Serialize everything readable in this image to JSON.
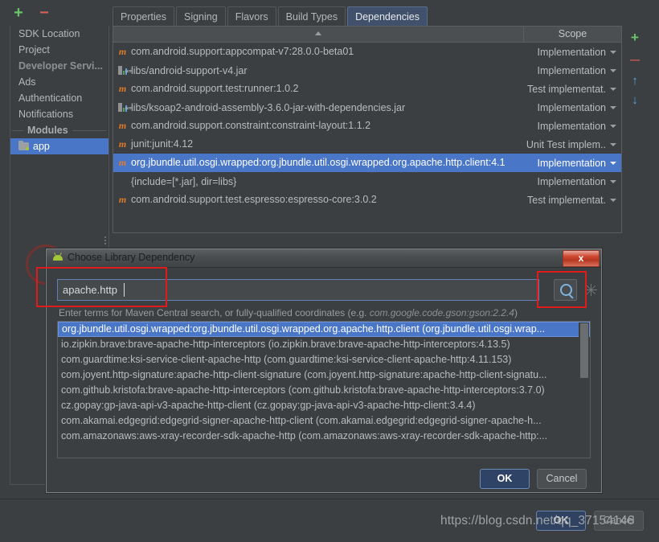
{
  "project_toolbar": {
    "add_label": "+",
    "remove_label": "−"
  },
  "sidebar": {
    "items": [
      {
        "label": "SDK Location",
        "style": "normal"
      },
      {
        "label": "Project",
        "style": "normal"
      },
      {
        "label": "Developer Servi...",
        "style": "dim"
      },
      {
        "label": "Ads",
        "style": "normal"
      },
      {
        "label": "Authentication",
        "style": "normal"
      },
      {
        "label": "Notifications",
        "style": "normal"
      }
    ],
    "group_label": "Modules",
    "module": {
      "label": "app",
      "icon": "folder-icon",
      "selected": true
    }
  },
  "tabs": [
    {
      "label": "Properties",
      "active": false
    },
    {
      "label": "Signing",
      "active": false
    },
    {
      "label": "Flavors",
      "active": false
    },
    {
      "label": "Build Types",
      "active": false
    },
    {
      "label": "Dependencies",
      "active": true
    }
  ],
  "dependencies_table": {
    "columns": [
      "",
      "Scope"
    ],
    "sort_indicator": "ascending",
    "rows": [
      {
        "icon": "maven-icon",
        "name": "com.android.support:appcompat-v7:28.0.0-beta01",
        "scope": "Implementation",
        "has_chevron": true,
        "selected": false
      },
      {
        "icon": "jar-icon",
        "name": "libs/android-support-v4.jar",
        "scope": "Implementation",
        "has_chevron": true,
        "selected": false
      },
      {
        "icon": "maven-icon",
        "name": "com.android.support.test:runner:1.0.2",
        "scope": "Test implementat.",
        "has_chevron": true,
        "selected": false
      },
      {
        "icon": "jar-icon",
        "name": "libs/ksoap2-android-assembly-3.6.0-jar-with-dependencies.jar",
        "scope": "Implementation",
        "has_chevron": true,
        "selected": false
      },
      {
        "icon": "maven-icon",
        "name": "com.android.support.constraint:constraint-layout:1.1.2",
        "scope": "Implementation",
        "has_chevron": true,
        "selected": false
      },
      {
        "icon": "maven-icon",
        "name": "junit:junit:4.12",
        "scope": "Unit Test implem..",
        "has_chevron": true,
        "selected": false
      },
      {
        "icon": "maven-icon",
        "name": "org.jbundle.util.osgi.wrapped:org.jbundle.util.osgi.wrapped.org.apache.http.client:4.1",
        "scope": "Implementation",
        "has_chevron": true,
        "selected": true
      },
      {
        "icon": "none",
        "name": "{include=[*.jar], dir=libs}",
        "scope": "Implementation",
        "has_chevron": true,
        "selected": false
      },
      {
        "icon": "maven-icon",
        "name": "com.android.support.test.espresso:espresso-core:3.0.2",
        "scope": "Test implementat.",
        "has_chevron": true,
        "selected": false
      }
    ]
  },
  "right_toolbar": {
    "add_label": "+",
    "remove_label": "─",
    "up_label": "↑",
    "down_label": "↓"
  },
  "dialog": {
    "title": "Choose Library Dependency",
    "close_label": "x",
    "search": {
      "value": "apache.http",
      "placeholder": "",
      "search_button_icon": "magnifier-icon"
    },
    "hint_prefix": "Enter terms for Maven Central search, or fully-qualified coordinates (e.g. ",
    "hint_example": "com.google.code.gson:gson:2.2.4",
    "hint_suffix": ")",
    "results": [
      {
        "label": "org.jbundle.util.osgi.wrapped:org.jbundle.util.osgi.wrapped.org.apache.http.client (org.jbundle.util.osgi.wrap...",
        "selected": true
      },
      {
        "label": "io.zipkin.brave:brave-apache-http-interceptors (io.zipkin.brave:brave-apache-http-interceptors:4.13.5)",
        "selected": false
      },
      {
        "label": "com.guardtime:ksi-service-client-apache-http (com.guardtime:ksi-service-client-apache-http:4.11.153)",
        "selected": false
      },
      {
        "label": "com.joyent.http-signature:apache-http-client-signature (com.joyent.http-signature:apache-http-client-signatu...",
        "selected": false
      },
      {
        "label": "com.github.kristofa:brave-apache-http-interceptors (com.github.kristofa:brave-apache-http-interceptors:3.7.0)",
        "selected": false
      },
      {
        "label": "cz.gopay:gp-java-api-v3-apache-http-client (cz.gopay:gp-java-api-v3-apache-http-client:3.4.4)",
        "selected": false
      },
      {
        "label": "com.akamai.edgegrid:edgegrid-signer-apache-http-client (com.akamai.edgegrid:edgegrid-signer-apache-h...",
        "selected": false
      },
      {
        "label": "com.amazonaws:aws-xray-recorder-sdk-apache-http (com.amazonaws:aws-xray-recorder-sdk-apache-http:...",
        "selected": false
      }
    ],
    "ok_label": "OK",
    "cancel_label": "Cancel"
  },
  "bottom_bar": {
    "ok_label": "OK",
    "cancel_label": "Cancel",
    "watermark": "https://blog.csdn.net/qq_37154146"
  },
  "colors": {
    "window_bg": "#3c3f41",
    "selection_blue": "#4a76c8",
    "accent_green": "#6ac46a",
    "accent_red": "#d2605a",
    "annotation_red": "#e01b1b",
    "maven_orange": "#e07b29",
    "tab_active_bg": "#41516b"
  }
}
